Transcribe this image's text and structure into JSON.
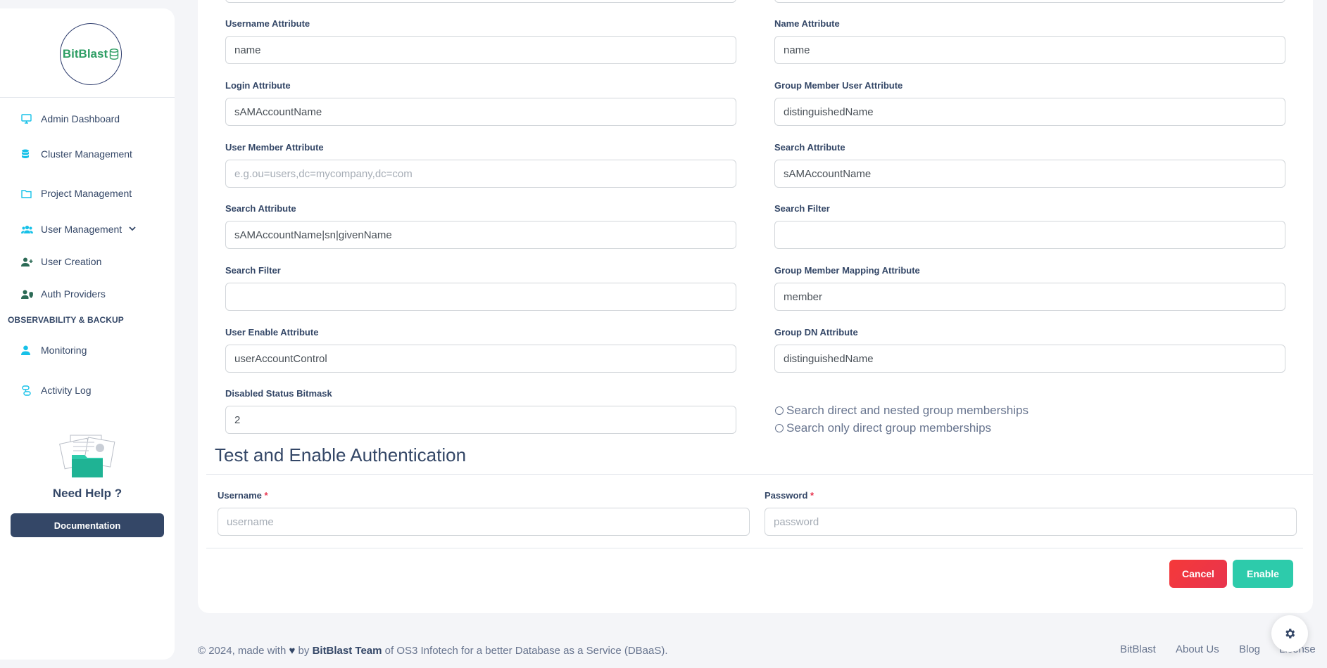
{
  "brand": {
    "name": "BitBlast"
  },
  "sidebar": {
    "items": [
      {
        "label": "Admin Dashboard",
        "icon": "monitor-icon"
      },
      {
        "label": "Cluster Management",
        "icon": "database-icon"
      },
      {
        "label": "Project Management",
        "icon": "folder-icon"
      },
      {
        "label": "User Management",
        "icon": "users-icon"
      },
      {
        "label": "User Creation",
        "icon": "user-plus-icon"
      },
      {
        "label": "Auth Providers",
        "icon": "user-shield-icon"
      }
    ],
    "section_label": "OBSERVABILITY & BACKUP",
    "section_items": [
      {
        "label": "Monitoring",
        "icon": "user-icon"
      },
      {
        "label": "Activity Log",
        "icon": "activity-icon"
      }
    ],
    "help_title": "Need Help ?",
    "doc_button": "Documentation"
  },
  "form": {
    "left": [
      {
        "label": "Username Attribute",
        "value": "name",
        "placeholder": ""
      },
      {
        "label": "Login Attribute",
        "value": "sAMAccountName",
        "placeholder": ""
      },
      {
        "label": "User Member Attribute",
        "value": "",
        "placeholder": "e.g.ou=users,dc=mycompany,dc=com"
      },
      {
        "label": "Search Attribute",
        "value": "sAMAccountName|sn|givenName",
        "placeholder": ""
      },
      {
        "label": "Search Filter",
        "value": "",
        "placeholder": ""
      },
      {
        "label": "User Enable Attribute",
        "value": "userAccountControl",
        "placeholder": ""
      },
      {
        "label": "Disabled Status Bitmask",
        "value": "2",
        "placeholder": ""
      }
    ],
    "right": [
      {
        "label": "Name Attribute",
        "value": "name",
        "placeholder": ""
      },
      {
        "label": "Group Member User Attribute",
        "value": "distinguishedName",
        "placeholder": ""
      },
      {
        "label": "Search Attribute",
        "value": "sAMAccountName",
        "placeholder": ""
      },
      {
        "label": "Search Filter",
        "value": "",
        "placeholder": ""
      },
      {
        "label": "Group Member Mapping Attribute",
        "value": "member",
        "placeholder": ""
      },
      {
        "label": "Group DN Attribute",
        "value": "distinguishedName",
        "placeholder": ""
      }
    ],
    "radios": [
      "Search direct and nested group memberships",
      "Search only direct group memberships"
    ]
  },
  "auth": {
    "title": "Test and Enable Authentication",
    "username_label": "Username",
    "username_placeholder": "username",
    "password_label": "Password",
    "password_placeholder": "password",
    "required_mark": "*",
    "cancel": "Cancel",
    "enable": "Enable"
  },
  "footer": {
    "prefix": "© 2024, made with",
    "by": "by",
    "team": "BitBlast Team",
    "suffix": "of OS3 Infotech for a better Database as a Service (DBaaS).",
    "links": [
      "BitBlast",
      "About Us",
      "Blog",
      "License"
    ]
  },
  "colors": {
    "accent": "#2dcbab",
    "danger": "#e8344e",
    "dark": "#344767",
    "brand_green": "#2e9e64"
  }
}
